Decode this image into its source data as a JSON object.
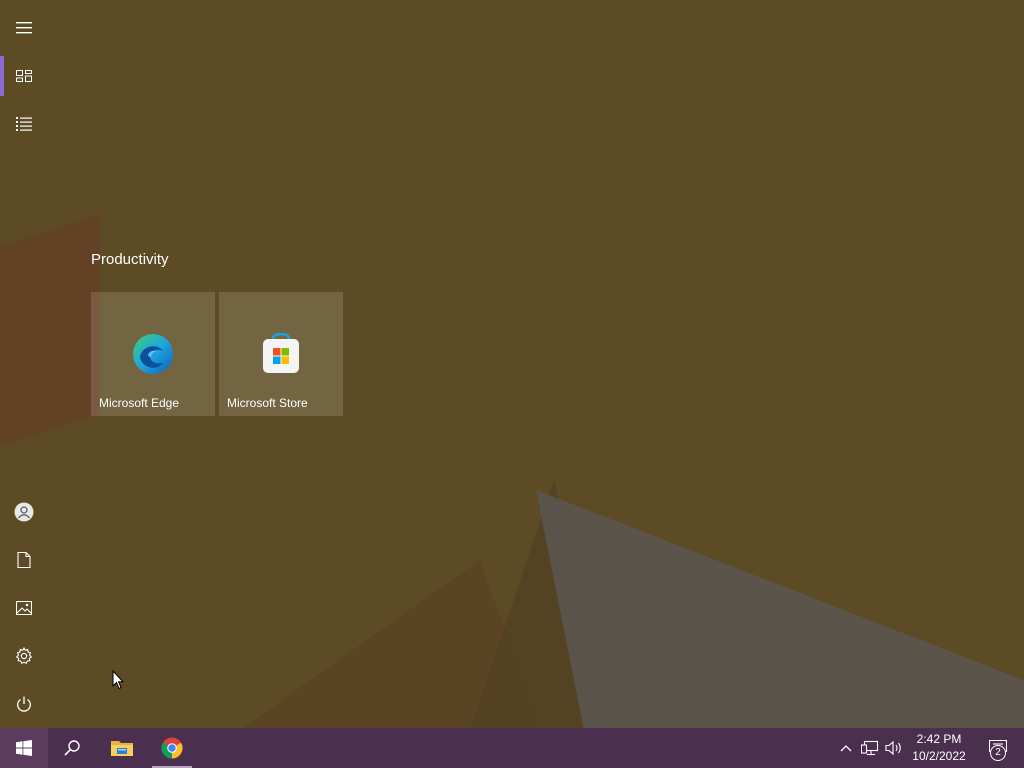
{
  "start_menu": {
    "rail": {
      "top_items": [
        {
          "name": "expand",
          "icon": "hamburger-icon"
        },
        {
          "name": "pinned-tiles",
          "icon": "tiles-icon",
          "active": true
        },
        {
          "name": "all-apps",
          "icon": "list-icon"
        }
      ],
      "bottom_items": [
        {
          "name": "account",
          "icon": "user-icon"
        },
        {
          "name": "documents",
          "icon": "document-icon"
        },
        {
          "name": "pictures",
          "icon": "picture-icon"
        },
        {
          "name": "settings",
          "icon": "gear-icon"
        },
        {
          "name": "power",
          "icon": "power-icon"
        }
      ]
    },
    "group_title": "Productivity",
    "tiles": [
      {
        "label": "Microsoft Edge",
        "icon": "edge-icon"
      },
      {
        "label": "Microsoft Store",
        "icon": "store-icon"
      }
    ]
  },
  "taskbar": {
    "buttons": [
      {
        "name": "start",
        "icon": "windows-logo-icon"
      },
      {
        "name": "search",
        "icon": "search-icon"
      },
      {
        "name": "file-explorer",
        "icon": "folder-icon"
      },
      {
        "name": "chrome",
        "icon": "chrome-icon",
        "running": true
      }
    ],
    "tray": {
      "icons": [
        "chevron-up-icon",
        "network-icon",
        "volume-icon"
      ],
      "time": "2:42 PM",
      "date": "10/2/2022",
      "notification_count": "2"
    }
  },
  "colors": {
    "accent": "#8a6bd4",
    "taskbar": "#4b2f4f",
    "start_bg": "#5c4b24"
  }
}
